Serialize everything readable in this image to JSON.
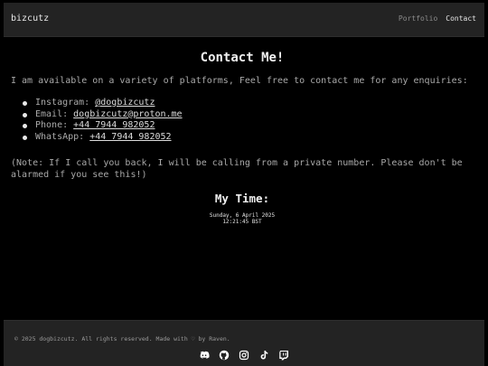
{
  "nav": {
    "brand": "bizcutz",
    "links": [
      {
        "label": "Portfolio",
        "active": false
      },
      {
        "label": "Contact",
        "active": true
      }
    ]
  },
  "main": {
    "title": "Contact Me!",
    "intro": "I am available on a variety of platforms, Feel free to contact me for any enquiries:",
    "contacts": [
      {
        "label": "Instagram: ",
        "value": "@dogbizcutz"
      },
      {
        "label": "Email: ",
        "value": "dogbizcutz@proton.me"
      },
      {
        "label": "Phone: ",
        "value": "+44 7944 982052"
      },
      {
        "label": "WhatsApp: ",
        "value": "+44 7944 982052"
      }
    ],
    "note": "(Note: If I call you back, I will be calling from a private number. Please don't be alarmed if you see this!)",
    "time_title": "My Time:",
    "clock": {
      "date": "Sunday, 6 April 2025",
      "time": "12:21:45 BST"
    }
  },
  "footer": {
    "copyright": "© 2025 dogbizcutz. All rights reserved. Made with ♡ by Raven.",
    "socials": [
      "discord-icon",
      "github-icon",
      "instagram-icon",
      "tiktok-icon",
      "twitch-icon"
    ]
  }
}
